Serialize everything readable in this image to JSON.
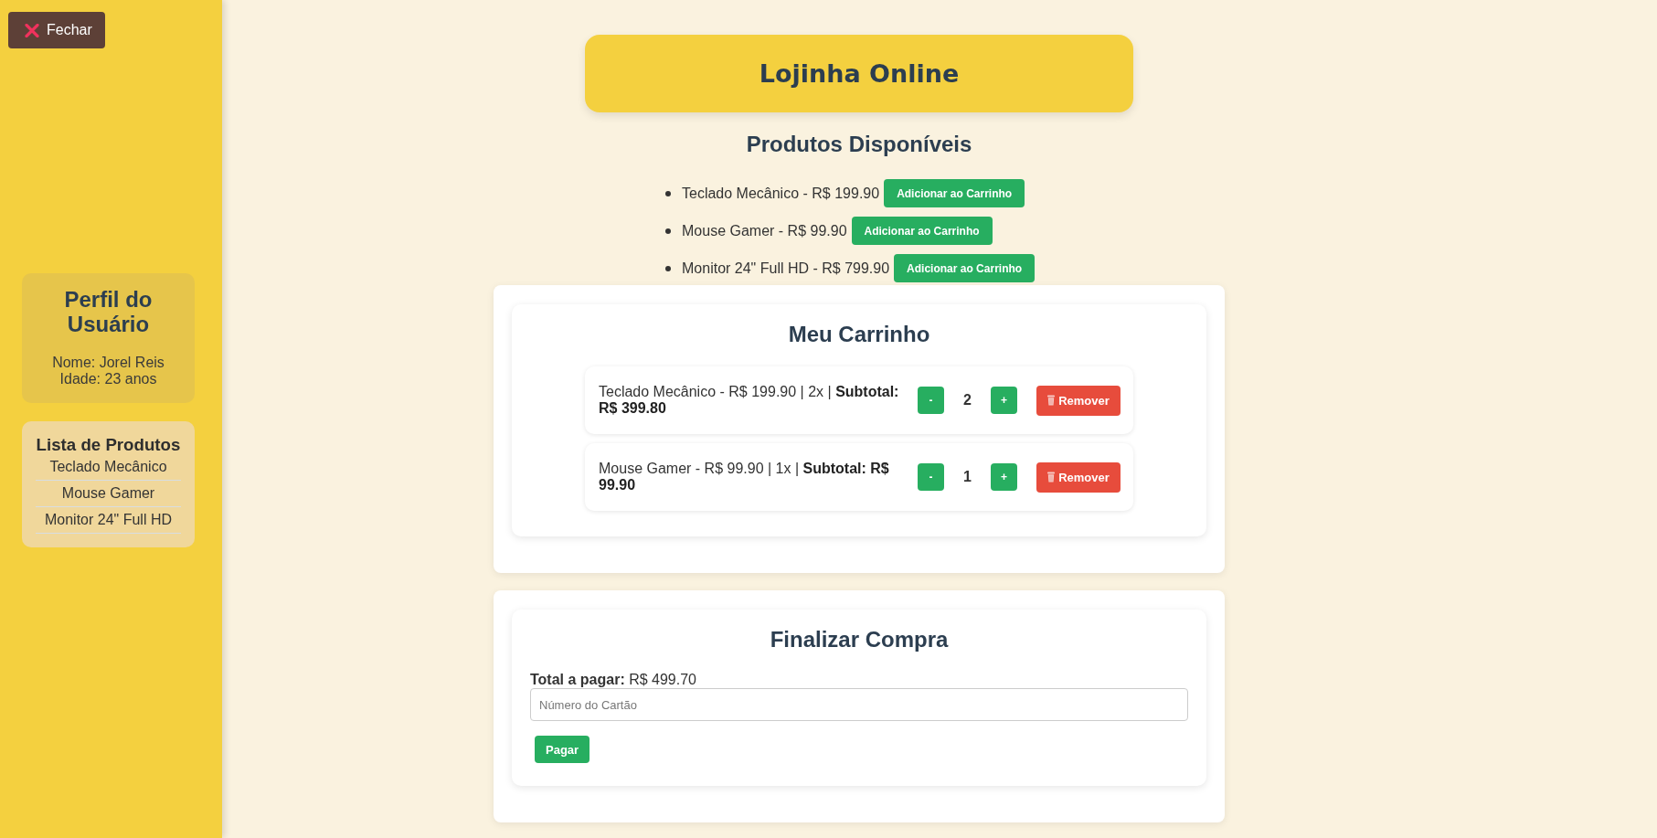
{
  "sidebar": {
    "close_button": {
      "label": "Fechar"
    },
    "profile": {
      "title": "Perfil do Usuário",
      "lines": [
        "Nome: Jorel Reis",
        "Idade: 23 anos"
      ]
    },
    "product_list": {
      "title": "Lista de Produtos",
      "items": [
        "Teclado Mecânico",
        "Mouse Gamer",
        "Monitor 24\" Full HD"
      ]
    }
  },
  "header": {
    "title": "Lojinha Online"
  },
  "products": {
    "title": "Produtos Disponíveis",
    "items": [
      {
        "text": "Teclado Mecânico - R$ 199.90",
        "button": "Adicionar ao Carrinho"
      },
      {
        "text": "Mouse Gamer - R$ 99.90",
        "button": "Adicionar ao Carrinho"
      },
      {
        "text": "Monitor 24\" Full HD - R$ 799.90",
        "button": "Adicionar ao Carrinho"
      }
    ]
  },
  "cart": {
    "title": "Meu Carrinho",
    "items": [
      {
        "text": "Teclado Mecânico - R$ 199.90 | 2x | **Subtotal: R$ 399.80**",
        "minus": "-",
        "quantity": "2",
        "plus": "+",
        "remove": "Remover"
      },
      {
        "text": "Mouse Gamer - R$ 99.90 | 1x | **Subtotal: R$ 99.90**",
        "minus": "-",
        "quantity": "1",
        "plus": "+",
        "remove": "Remover"
      }
    ]
  },
  "checkout": {
    "title": "Finalizar Compra",
    "total": "**Total a pagar:** R$ 499.70",
    "card_field": {
      "placeholder": "Número do Cartão"
    },
    "pay_button": "Pagar"
  }
}
